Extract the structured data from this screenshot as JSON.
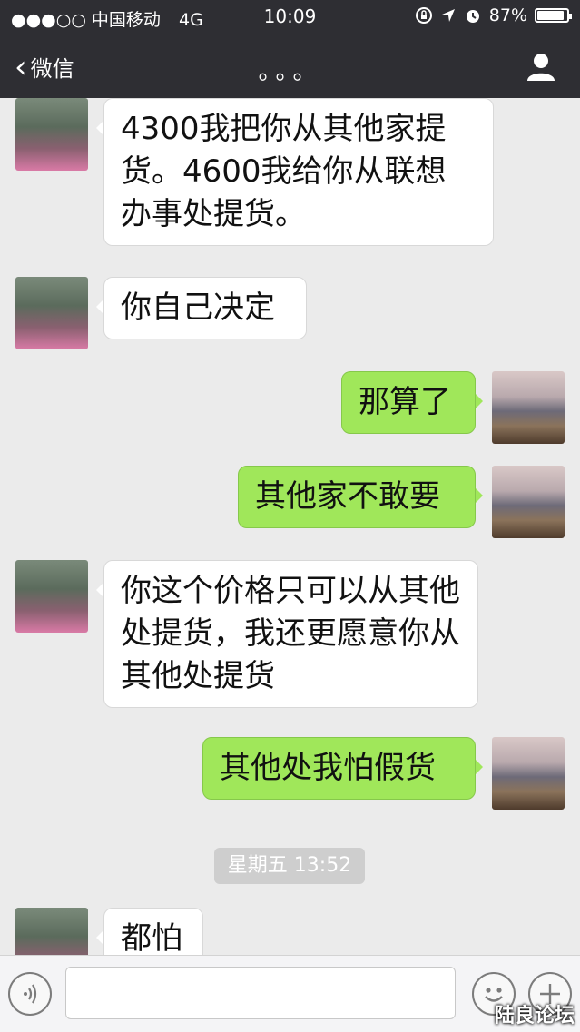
{
  "status": {
    "carrier": "●●●○○ 中国移动",
    "network": "4G",
    "time": "10:09",
    "battery": "87%"
  },
  "nav": {
    "back_label": "微信",
    "title": "。。。"
  },
  "messages": [
    {
      "side": "in",
      "text": "4300我把你从其他家提货。4600我给你从联想办事处提货。"
    },
    {
      "side": "in",
      "text": "你自己决定"
    },
    {
      "side": "out",
      "text": "那算了"
    },
    {
      "side": "out",
      "text": "其他家不敢要"
    },
    {
      "side": "in",
      "text": "你这个价格只可以从其他处提货，我还更愿意你从其他处提货"
    },
    {
      "side": "out",
      "text": "其他处我怕假货"
    },
    {
      "side": "in",
      "text": "都怕"
    }
  ],
  "timestamp": "星期五 13:52",
  "watermark": "陆良论坛",
  "colors": {
    "outgoing_bubble": "#a0e75a",
    "incoming_bubble": "#ffffff",
    "nav_background": "#2e2e33"
  }
}
